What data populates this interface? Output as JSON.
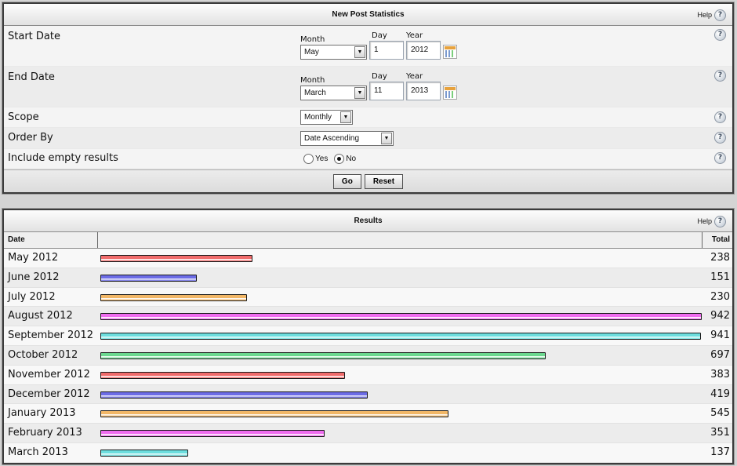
{
  "stats_panel": {
    "title": "New Post Statistics",
    "help_label": "Help",
    "help_icon": "?",
    "rows": {
      "start_date": {
        "label": "Start Date",
        "month_caption": "Month",
        "day_caption": "Day",
        "year_caption": "Year",
        "month": "May",
        "day": "1",
        "year": "2012"
      },
      "end_date": {
        "label": "End Date",
        "month_caption": "Month",
        "day_caption": "Day",
        "year_caption": "Year",
        "month": "March",
        "day": "11",
        "year": "2013"
      },
      "scope": {
        "label": "Scope",
        "value": "Monthly"
      },
      "order_by": {
        "label": "Order By",
        "value": "Date Ascending"
      },
      "include_empty": {
        "label": "Include empty results",
        "yes_label": "Yes",
        "no_label": "No",
        "selected": "No"
      }
    },
    "buttons": {
      "go": "Go",
      "reset": "Reset"
    },
    "select_arrow": "▼",
    "calendar_icon": "calendar-icon"
  },
  "results_panel": {
    "title": "Results",
    "help_label": "Help",
    "help_icon": "?",
    "columns": {
      "date": "Date",
      "total": "Total"
    },
    "max_total": 942
  },
  "chart_data": {
    "type": "bar",
    "categories": [
      "May 2012",
      "June 2012",
      "July 2012",
      "August 2012",
      "September 2012",
      "October 2012",
      "November 2012",
      "December 2012",
      "January 2013",
      "February 2013",
      "March 2013"
    ],
    "values": [
      238,
      151,
      230,
      942,
      941,
      697,
      383,
      419,
      545,
      351,
      137
    ],
    "colors": [
      "#f06b6b",
      "#6c6ce6",
      "#f2b766",
      "#ef6cef",
      "#6cdede",
      "#6cd88f",
      "#f06b6b",
      "#6c6ce6",
      "#f2b766",
      "#ef6cef",
      "#6cdede"
    ],
    "title": "Results",
    "xlabel": "Date",
    "ylabel": "Total",
    "orientation": "horizontal"
  }
}
